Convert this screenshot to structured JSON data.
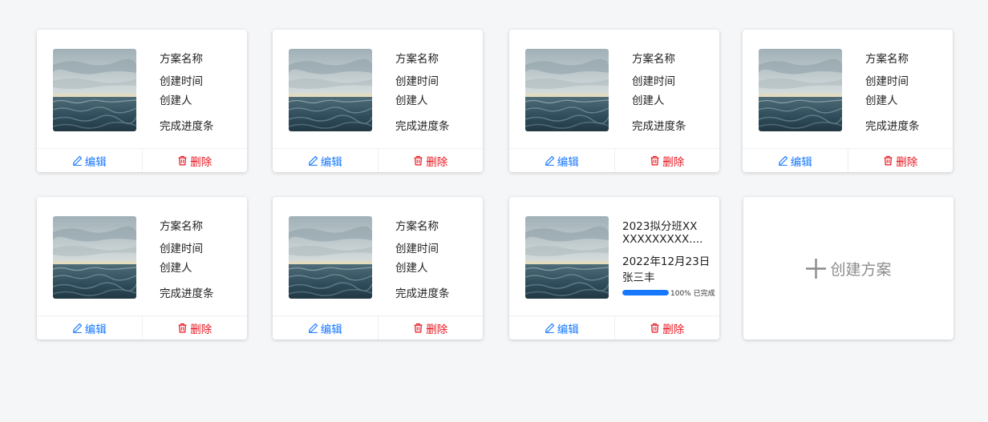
{
  "cards": [
    {
      "name": "方案名称",
      "created_time": "创建时间",
      "creator": "创建人",
      "progress_label": "完成进度条",
      "edit": "编辑",
      "delete": "删除"
    },
    {
      "name": "方案名称",
      "created_time": "创建时间",
      "creator": "创建人",
      "progress_label": "完成进度条",
      "edit": "编辑",
      "delete": "删除"
    },
    {
      "name": "方案名称",
      "created_time": "创建时间",
      "creator": "创建人",
      "progress_label": "完成进度条",
      "edit": "编辑",
      "delete": "删除"
    },
    {
      "name": "方案名称",
      "created_time": "创建时间",
      "creator": "创建人",
      "progress_label": "完成进度条",
      "edit": "编辑",
      "delete": "删除"
    },
    {
      "name": "方案名称",
      "created_time": "创建时间",
      "creator": "创建人",
      "progress_label": "完成进度条",
      "edit": "编辑",
      "delete": "删除"
    },
    {
      "name": "方案名称",
      "created_time": "创建时间",
      "creator": "创建人",
      "progress_label": "完成进度条",
      "edit": "编辑",
      "delete": "删除"
    }
  ],
  "filled_card": {
    "name_line1": "2023拟分班XX",
    "name_line2": "XXXXXXXXX....",
    "date": "2022年12月23日",
    "creator": "张三丰",
    "progress_percent": 100,
    "progress_text": "100% 已完成",
    "edit": "编辑",
    "delete": "删除"
  },
  "create": {
    "label": "创建方案",
    "icon": "plus-icon"
  },
  "icons": {
    "edit": "edit-icon",
    "delete": "trash-icon",
    "thumbnail": "sea-image"
  },
  "colors": {
    "primary": "#1677ff",
    "danger": "#e8141e",
    "muted": "#8c8c8c",
    "background": "#f5f6f8"
  }
}
